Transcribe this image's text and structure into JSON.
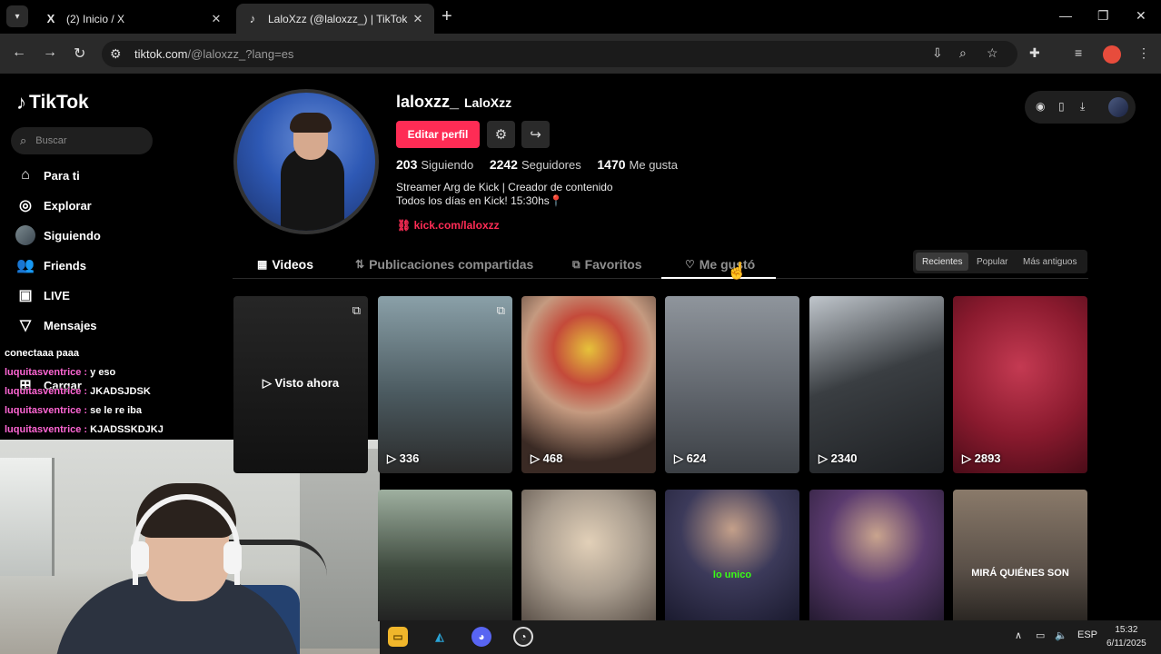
{
  "browser": {
    "tabs": [
      {
        "title": "(2) Inicio / X",
        "favicon": "X"
      },
      {
        "title": "LaloXzz (@laloxzz_) | TikTok",
        "favicon": "♪"
      }
    ],
    "url_host": "tiktok.com",
    "url_rest": "/@laloxzz_?lang=es"
  },
  "sidebar": {
    "brand": "TikTok",
    "search_placeholder": "Buscar",
    "items": [
      {
        "label": "Para ti",
        "icon": "home-icon"
      },
      {
        "label": "Explorar",
        "icon": "compass-icon"
      },
      {
        "label": "Siguiendo",
        "icon": "avatar"
      },
      {
        "label": "Friends",
        "icon": "friends-icon"
      },
      {
        "label": "LIVE",
        "icon": "live-icon"
      },
      {
        "label": "Mensajes",
        "icon": "send-icon"
      },
      {
        "label": "Cargar",
        "icon": "plus-icon"
      }
    ]
  },
  "chat": [
    {
      "user": "",
      "msg": "conectaaa paaa"
    },
    {
      "user": "luquitasventrice :",
      "msg": "y eso"
    },
    {
      "user": "luquitasventrice :",
      "msg": "JKADSJDSK"
    },
    {
      "user": "luquitasventrice :",
      "msg": "se le re iba"
    },
    {
      "user": "luquitasventrice :",
      "msg": "KJADSSKDJKJ"
    }
  ],
  "profile": {
    "username": "laloxzz_",
    "nickname": "LaloXzz",
    "edit_label": "Editar perfil",
    "following_count": "203",
    "following_label": "Siguiendo",
    "followers_count": "2242",
    "followers_label": "Seguidores",
    "likes_count": "1470",
    "likes_label": "Me gusta",
    "bio_line1": "Streamer Arg de Kick | Creador de contenido",
    "bio_line2": "Todos los días en Kick! 15:30hs📍",
    "link": "kick.com/laloxzz"
  },
  "profile_tabs": [
    "Videos",
    "Publicaciones compartidas",
    "Favoritos",
    "Me gustó"
  ],
  "sort_options": [
    "Recientes",
    "Popular",
    "Más antiguos"
  ],
  "videos_row1": [
    {
      "views": "",
      "overlay": "Visto ahora",
      "bg": "#1b1b1b"
    },
    {
      "views": "336",
      "bg": "#5b6a72"
    },
    {
      "views": "468",
      "bg": "#8a6a55"
    },
    {
      "views": "624",
      "bg": "#6b7078"
    },
    {
      "views": "2340",
      "bg": "#3a3e42"
    },
    {
      "views": "2893",
      "bg": "#8a1a2e"
    }
  ],
  "videos_row2": [
    {
      "caption": "",
      "bg": "#4a5a4a"
    },
    {
      "caption": "",
      "bg": "#a89c8e"
    },
    {
      "caption": "lo unico",
      "bg": "#3c3a5a"
    },
    {
      "caption": "",
      "bg": "#4a3a5a"
    },
    {
      "caption": "MIRÁ QUIÉNES SON",
      "bg": "#5a5048"
    }
  ],
  "taskbar": {
    "lang": "ESP",
    "time": "15:32",
    "date": "6/11/2025"
  },
  "colors": {
    "accent": "#fe2c55",
    "chat_user": "#ff66d4",
    "background": "#000000"
  }
}
